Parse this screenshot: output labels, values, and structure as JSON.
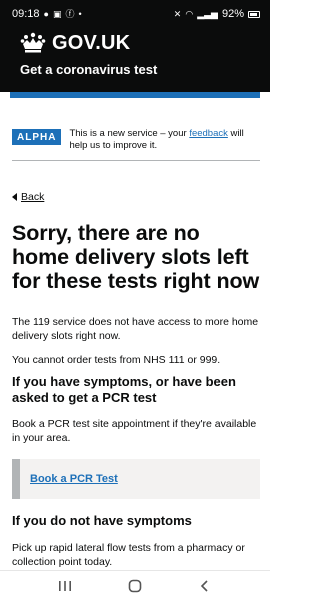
{
  "status_bar": {
    "time": "09:18",
    "battery": "92%"
  },
  "header": {
    "logotype": "GOV.UK",
    "service_name": "Get a coronavirus test",
    "icon": "crown-icon"
  },
  "phase_banner": {
    "tag": "ALPHA",
    "text_before": "This is a new service – your ",
    "link_text": "feedback",
    "text_after": " will help us to improve it."
  },
  "back_link": {
    "label": "Back"
  },
  "main": {
    "title": "Sorry, there are no home delivery slots left for these tests right now",
    "paragraph_1": "The 119 service does not have access to more home delivery slots right now.",
    "paragraph_2": "You cannot order tests from NHS 111 or 999.",
    "heading_symptoms": "If you have symptoms, or have been asked to get a PCR test",
    "paragraph_3": "Book a PCR test site appointment if they're available in your area.",
    "pcr_link": "Book a PCR Test",
    "heading_no_symptoms": "If you do not have symptoms",
    "paragraph_4": "Pick up rapid lateral flow tests from a pharmacy or collection point today."
  },
  "colors": {
    "header_bg": "#0b0c0c",
    "brand_blue": "#1d70b8",
    "inset_border": "#b1b4b6"
  }
}
